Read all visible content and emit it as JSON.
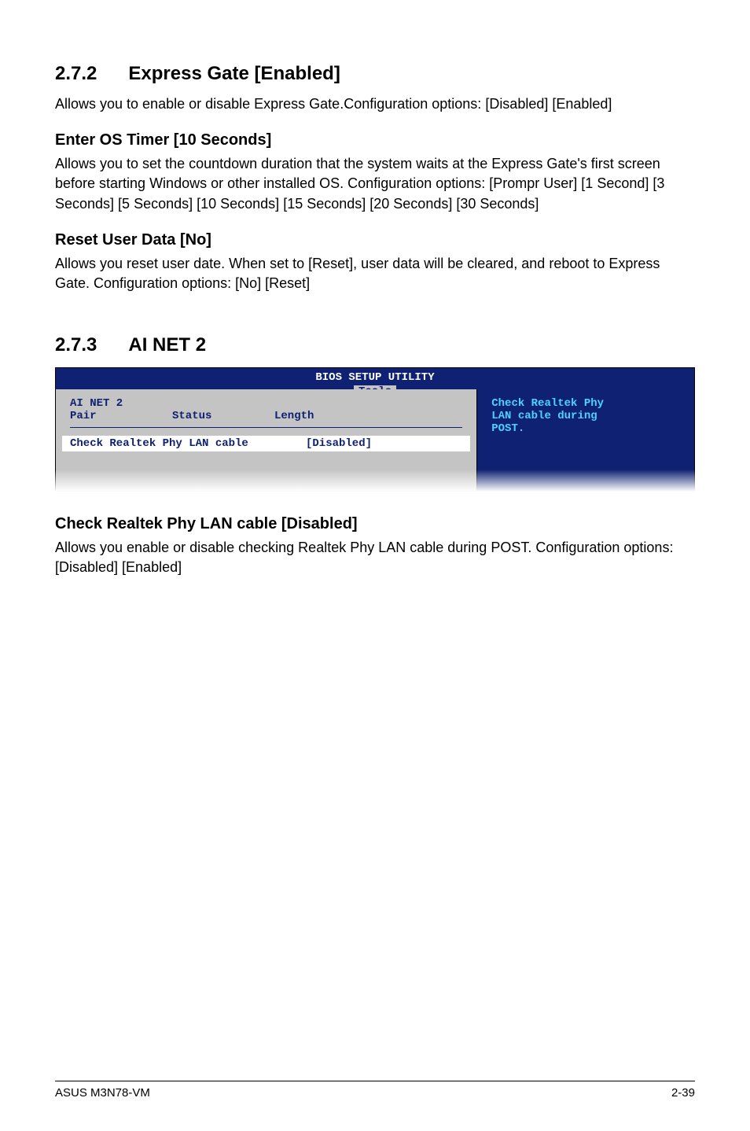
{
  "section1": {
    "number": "2.7.2",
    "title": "Express Gate [Enabled]",
    "desc": "Allows you to enable or disable Express Gate.Configuration options: [Disabled] [Enabled]"
  },
  "sub1": {
    "heading": "Enter OS Timer [10 Seconds]",
    "text": "Allows you to set the countdown duration that the system waits at the Express Gate's first screen before starting Windows or other installed OS. Configuration options: [Prompr User] [1 Second] [3 Seconds] [5 Seconds] [10 Seconds] [15 Seconds] [20 Seconds] [30 Seconds]"
  },
  "sub2": {
    "heading": "Reset User Data [No]",
    "text": "Allows you reset user date. When set to [Reset], user data will be cleared, and reboot to Express Gate. Configuration options: [No] [Reset]"
  },
  "section2": {
    "number": "2.7.3",
    "title": "AI NET 2"
  },
  "bios": {
    "title": "BIOS SETUP UTILITY",
    "tab": "Tools",
    "left": {
      "row1_col1": "AI NET 2",
      "row2_col1": "Pair",
      "row2_col2": "Status",
      "row2_col3": "Length",
      "selected_label": "Check Realtek Phy LAN cable",
      "selected_value": "[Disabled]"
    },
    "right": {
      "line1": "Check Realtek Phy",
      "line2": "LAN cable during",
      "line3": "POST."
    }
  },
  "sub3": {
    "heading": "Check Realtek Phy LAN cable [Disabled]",
    "text": "Allows you enable or disable checking Realtek Phy LAN cable during POST. Configuration options: [Disabled] [Enabled]"
  },
  "footer": {
    "left": "ASUS M3N78-VM",
    "right": "2-39"
  }
}
